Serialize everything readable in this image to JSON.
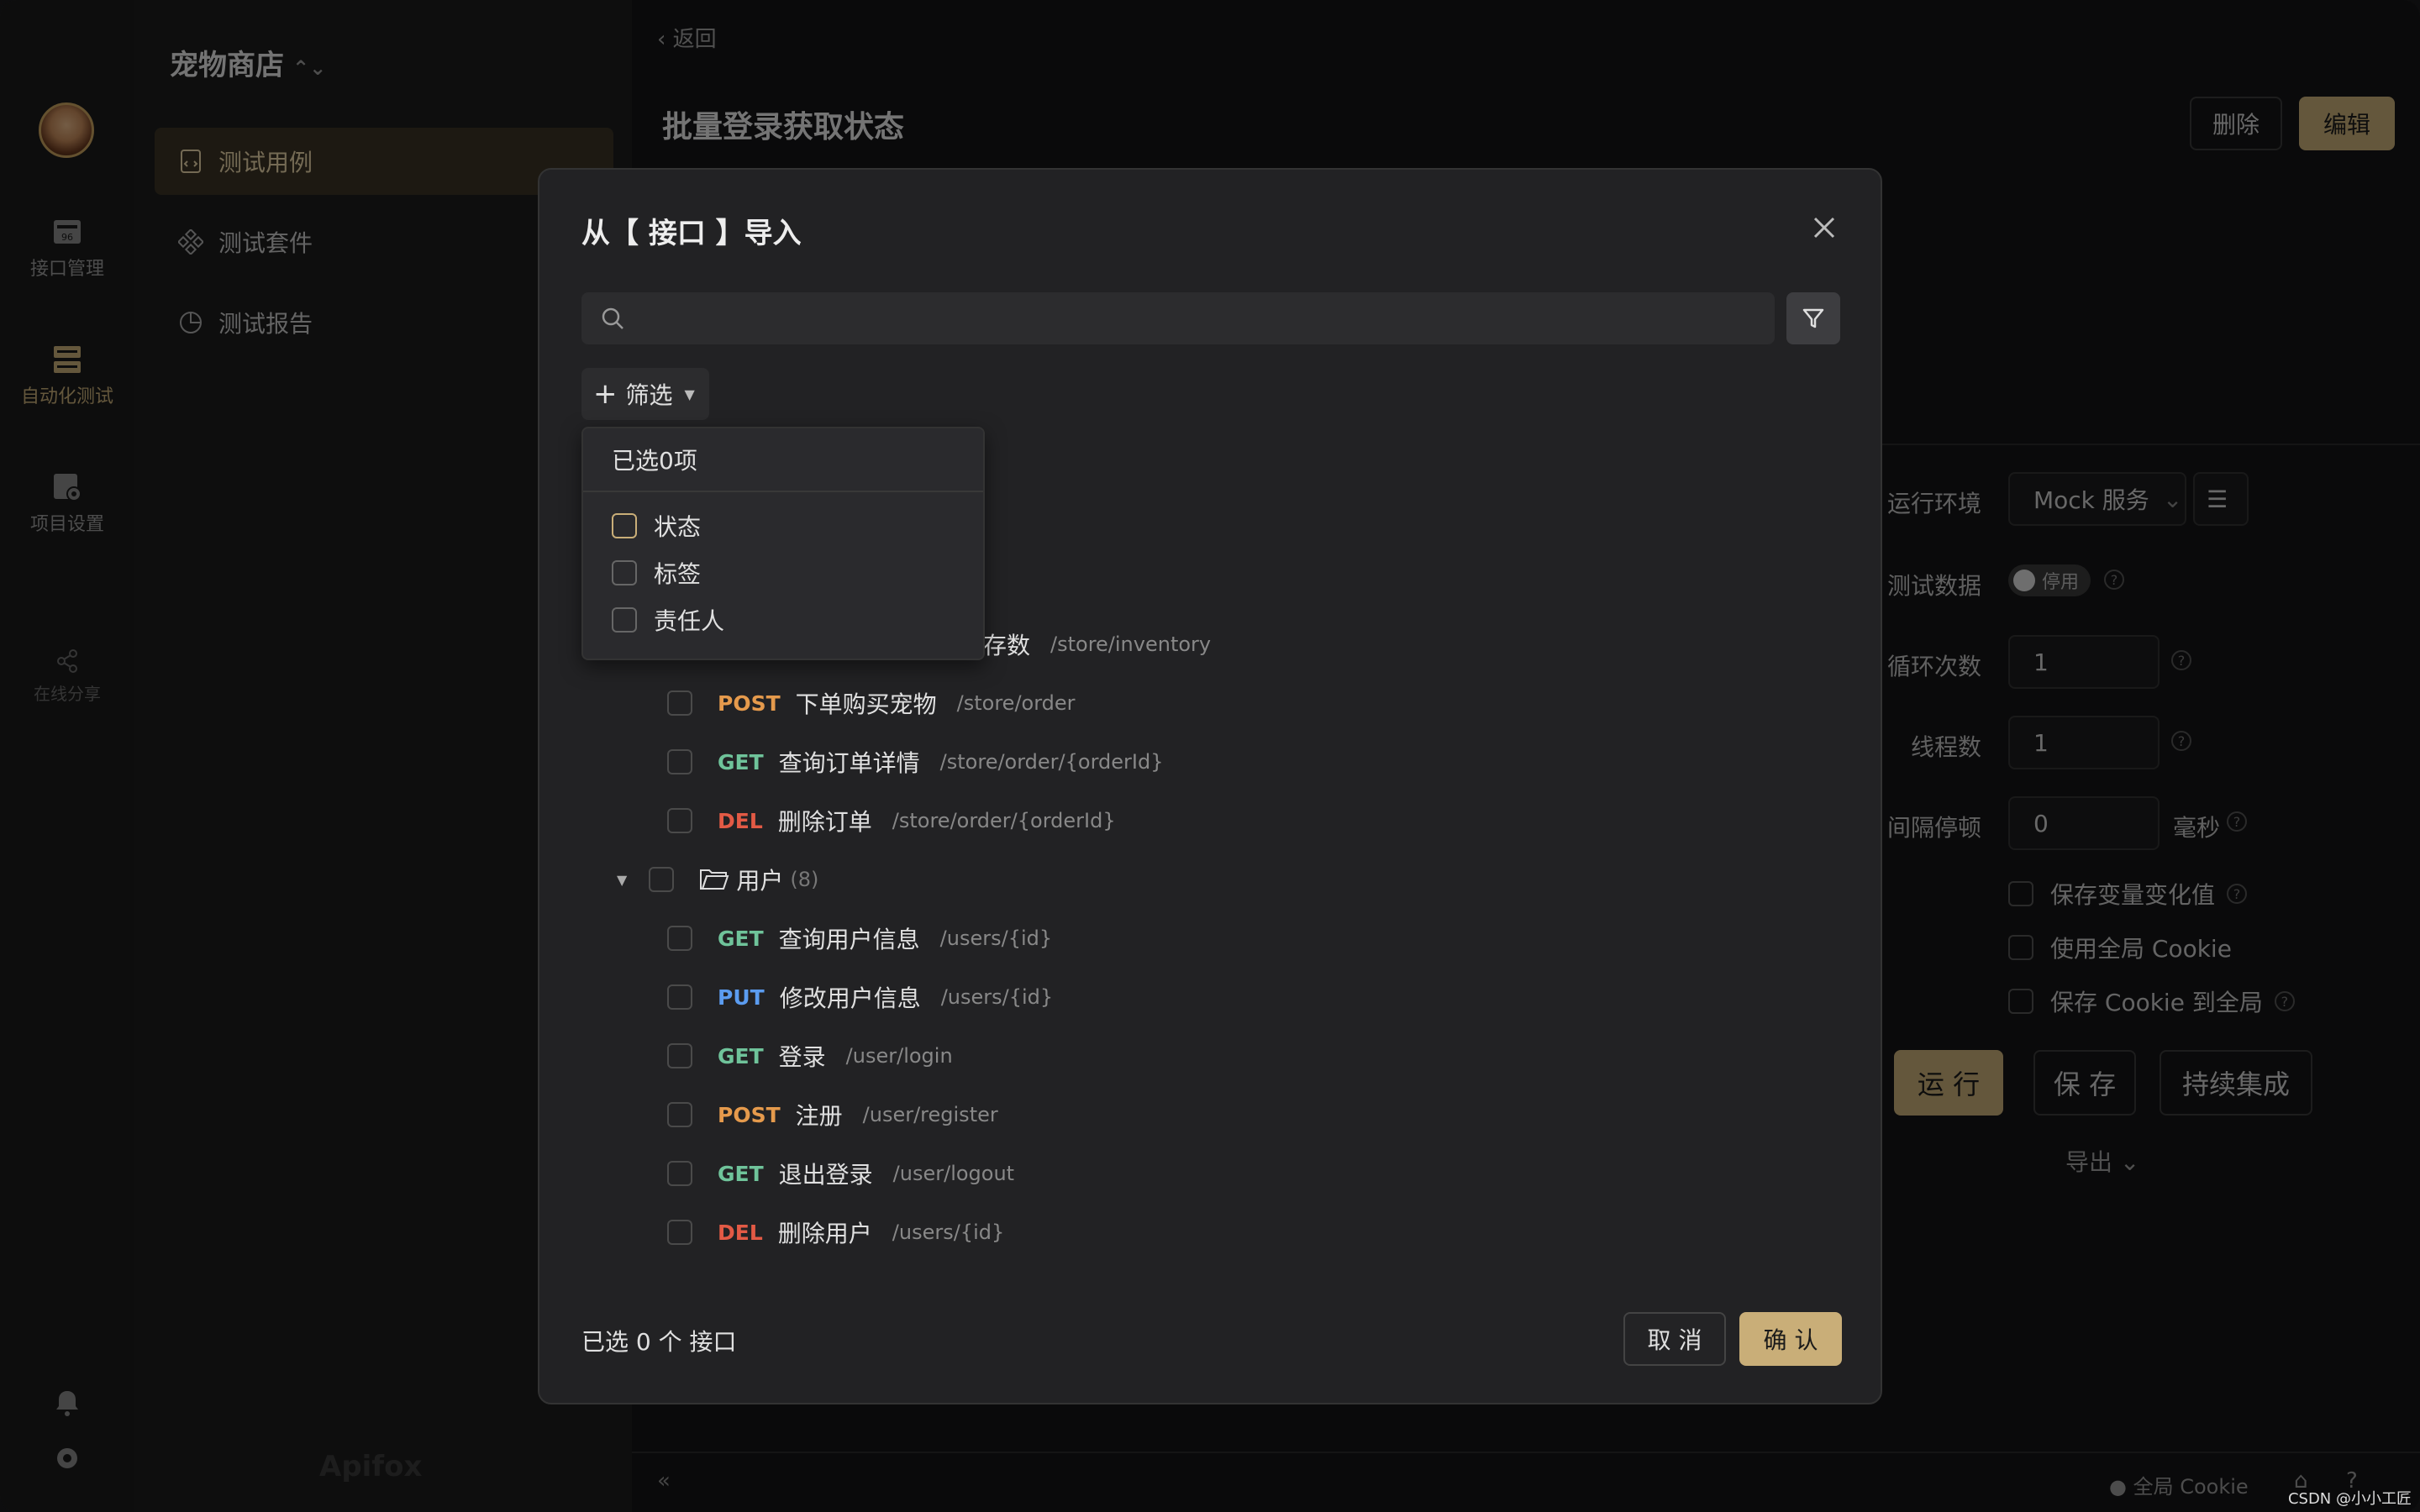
{
  "colors": {
    "accent": "#c9ae78",
    "get": "#6fc39a",
    "post": "#e59a4c",
    "put": "#5b9cf0",
    "del": "#e35a45"
  },
  "rail": {
    "items": [
      {
        "label": "接口管理",
        "icon": "api-management-icon"
      },
      {
        "label": "自动化测试",
        "icon": "automation-test-icon"
      },
      {
        "label": "项目设置",
        "icon": "project-settings-icon"
      },
      {
        "label": "在线分享",
        "icon": "share-icon"
      }
    ]
  },
  "sidebar": {
    "project": "宠物商店",
    "items": [
      {
        "label": "测试用例",
        "active": true
      },
      {
        "label": "测试套件"
      },
      {
        "label": "测试报告"
      }
    ],
    "brand": "Apifox"
  },
  "main": {
    "back": "返回",
    "title": "批量登录获取状态",
    "delete_label": "删除",
    "edit_label": "编辑",
    "settings": {
      "env_label": "运行环境",
      "env_value": "Mock 服务",
      "testdata_label": "测试数据",
      "testdata_toggle": "停用",
      "loops_label": "循环次数",
      "loops_value": "1",
      "threads_label": "线程数",
      "threads_value": "1",
      "interval_label": "间隔停顿",
      "interval_value": "0",
      "interval_unit": "毫秒",
      "save_var": "保存变量变化值",
      "use_cookie": "使用全局 Cookie",
      "save_cookie": "保存 Cookie 到全局"
    },
    "run_label": "运 行",
    "save_label": "保 存",
    "ci_label": "持续集成",
    "export_label": "导出"
  },
  "statusbar": {
    "cookie": "全局 Cookie"
  },
  "modal": {
    "title": "从【 接口 】导入",
    "search_placeholder": "",
    "filter_label": "筛选",
    "dropdown": {
      "header": "已选0项",
      "options": [
        "状态",
        "标签",
        "责任人"
      ]
    },
    "partial_row": {
      "name_tail": "存数",
      "path": "/store/inventory"
    },
    "rows": [
      {
        "method": "POST",
        "name": "下单购买宠物",
        "path": "/store/order"
      },
      {
        "method": "GET",
        "name": "查询订单详情",
        "path": "/store/order/{orderId}"
      },
      {
        "method": "DEL",
        "name": "删除订单",
        "path": "/store/order/{orderId}"
      }
    ],
    "folder": {
      "name": "用户",
      "count": "(8)"
    },
    "user_rows": [
      {
        "method": "GET",
        "name": "查询用户信息",
        "path": "/users/{id}"
      },
      {
        "method": "PUT",
        "name": "修改用户信息",
        "path": "/users/{id}"
      },
      {
        "method": "GET",
        "name": "登录",
        "path": "/user/login"
      },
      {
        "method": "POST",
        "name": "注册",
        "path": "/user/register"
      },
      {
        "method": "GET",
        "name": "退出登录",
        "path": "/user/logout"
      },
      {
        "method": "DEL",
        "name": "删除用户",
        "path": "/users/{id}"
      }
    ],
    "footer_count": "已选 0 个 接口",
    "cancel_label": "取 消",
    "ok_label": "确 认"
  },
  "watermark": "CSDN @小小工匠"
}
